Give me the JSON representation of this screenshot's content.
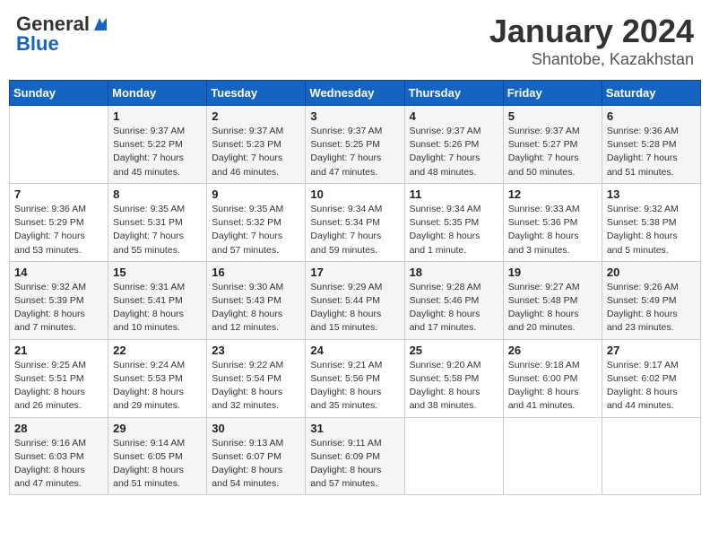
{
  "header": {
    "logo_general": "General",
    "logo_blue": "Blue",
    "title": "January 2024",
    "location": "Shantobe, Kazakhstan"
  },
  "weekdays": [
    "Sunday",
    "Monday",
    "Tuesday",
    "Wednesday",
    "Thursday",
    "Friday",
    "Saturday"
  ],
  "weeks": [
    [
      {
        "day": "",
        "info": ""
      },
      {
        "day": "1",
        "info": "Sunrise: 9:37 AM\nSunset: 5:22 PM\nDaylight: 7 hours\nand 45 minutes."
      },
      {
        "day": "2",
        "info": "Sunrise: 9:37 AM\nSunset: 5:23 PM\nDaylight: 7 hours\nand 46 minutes."
      },
      {
        "day": "3",
        "info": "Sunrise: 9:37 AM\nSunset: 5:25 PM\nDaylight: 7 hours\nand 47 minutes."
      },
      {
        "day": "4",
        "info": "Sunrise: 9:37 AM\nSunset: 5:26 PM\nDaylight: 7 hours\nand 48 minutes."
      },
      {
        "day": "5",
        "info": "Sunrise: 9:37 AM\nSunset: 5:27 PM\nDaylight: 7 hours\nand 50 minutes."
      },
      {
        "day": "6",
        "info": "Sunrise: 9:36 AM\nSunset: 5:28 PM\nDaylight: 7 hours\nand 51 minutes."
      }
    ],
    [
      {
        "day": "7",
        "info": "Sunrise: 9:36 AM\nSunset: 5:29 PM\nDaylight: 7 hours\nand 53 minutes."
      },
      {
        "day": "8",
        "info": "Sunrise: 9:35 AM\nSunset: 5:31 PM\nDaylight: 7 hours\nand 55 minutes."
      },
      {
        "day": "9",
        "info": "Sunrise: 9:35 AM\nSunset: 5:32 PM\nDaylight: 7 hours\nand 57 minutes."
      },
      {
        "day": "10",
        "info": "Sunrise: 9:34 AM\nSunset: 5:34 PM\nDaylight: 7 hours\nand 59 minutes."
      },
      {
        "day": "11",
        "info": "Sunrise: 9:34 AM\nSunset: 5:35 PM\nDaylight: 8 hours\nand 1 minute."
      },
      {
        "day": "12",
        "info": "Sunrise: 9:33 AM\nSunset: 5:36 PM\nDaylight: 8 hours\nand 3 minutes."
      },
      {
        "day": "13",
        "info": "Sunrise: 9:32 AM\nSunset: 5:38 PM\nDaylight: 8 hours\nand 5 minutes."
      }
    ],
    [
      {
        "day": "14",
        "info": "Sunrise: 9:32 AM\nSunset: 5:39 PM\nDaylight: 8 hours\nand 7 minutes."
      },
      {
        "day": "15",
        "info": "Sunrise: 9:31 AM\nSunset: 5:41 PM\nDaylight: 8 hours\nand 10 minutes."
      },
      {
        "day": "16",
        "info": "Sunrise: 9:30 AM\nSunset: 5:43 PM\nDaylight: 8 hours\nand 12 minutes."
      },
      {
        "day": "17",
        "info": "Sunrise: 9:29 AM\nSunset: 5:44 PM\nDaylight: 8 hours\nand 15 minutes."
      },
      {
        "day": "18",
        "info": "Sunrise: 9:28 AM\nSunset: 5:46 PM\nDaylight: 8 hours\nand 17 minutes."
      },
      {
        "day": "19",
        "info": "Sunrise: 9:27 AM\nSunset: 5:48 PM\nDaylight: 8 hours\nand 20 minutes."
      },
      {
        "day": "20",
        "info": "Sunrise: 9:26 AM\nSunset: 5:49 PM\nDaylight: 8 hours\nand 23 minutes."
      }
    ],
    [
      {
        "day": "21",
        "info": "Sunrise: 9:25 AM\nSunset: 5:51 PM\nDaylight: 8 hours\nand 26 minutes."
      },
      {
        "day": "22",
        "info": "Sunrise: 9:24 AM\nSunset: 5:53 PM\nDaylight: 8 hours\nand 29 minutes."
      },
      {
        "day": "23",
        "info": "Sunrise: 9:22 AM\nSunset: 5:54 PM\nDaylight: 8 hours\nand 32 minutes."
      },
      {
        "day": "24",
        "info": "Sunrise: 9:21 AM\nSunset: 5:56 PM\nDaylight: 8 hours\nand 35 minutes."
      },
      {
        "day": "25",
        "info": "Sunrise: 9:20 AM\nSunset: 5:58 PM\nDaylight: 8 hours\nand 38 minutes."
      },
      {
        "day": "26",
        "info": "Sunrise: 9:18 AM\nSunset: 6:00 PM\nDaylight: 8 hours\nand 41 minutes."
      },
      {
        "day": "27",
        "info": "Sunrise: 9:17 AM\nSunset: 6:02 PM\nDaylight: 8 hours\nand 44 minutes."
      }
    ],
    [
      {
        "day": "28",
        "info": "Sunrise: 9:16 AM\nSunset: 6:03 PM\nDaylight: 8 hours\nand 47 minutes."
      },
      {
        "day": "29",
        "info": "Sunrise: 9:14 AM\nSunset: 6:05 PM\nDaylight: 8 hours\nand 51 minutes."
      },
      {
        "day": "30",
        "info": "Sunrise: 9:13 AM\nSunset: 6:07 PM\nDaylight: 8 hours\nand 54 minutes."
      },
      {
        "day": "31",
        "info": "Sunrise: 9:11 AM\nSunset: 6:09 PM\nDaylight: 8 hours\nand 57 minutes."
      },
      {
        "day": "",
        "info": ""
      },
      {
        "day": "",
        "info": ""
      },
      {
        "day": "",
        "info": ""
      }
    ]
  ]
}
